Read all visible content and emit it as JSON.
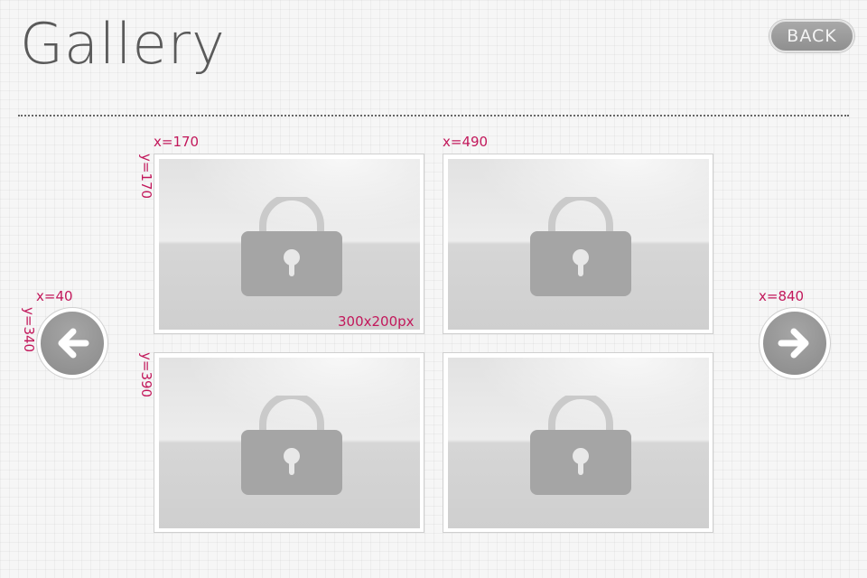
{
  "header": {
    "title": "Gallery",
    "back_label": "BACK"
  },
  "gallery": {
    "thumbnails": [
      {
        "icon": "lock-icon",
        "locked": true
      },
      {
        "icon": "lock-icon",
        "locked": true
      },
      {
        "icon": "lock-icon",
        "locked": true
      },
      {
        "icon": "lock-icon",
        "locked": true
      }
    ]
  },
  "navigation": {
    "prev_icon": "arrow-left-icon",
    "next_icon": "arrow-right-icon"
  },
  "annotations": {
    "thumb1_x": "x=170",
    "thumb1_y": "y=170",
    "thumb1_size": "300x200px",
    "thumb2_x": "x=490",
    "thumb3_y": "y=390",
    "prev_x": "x=40",
    "prev_y": "y=340",
    "next_x": "x=840"
  },
  "colors": {
    "background": "#f6f6f6",
    "title": "#5a5a5a",
    "button": "#999999",
    "annotation": "#c2185b"
  }
}
